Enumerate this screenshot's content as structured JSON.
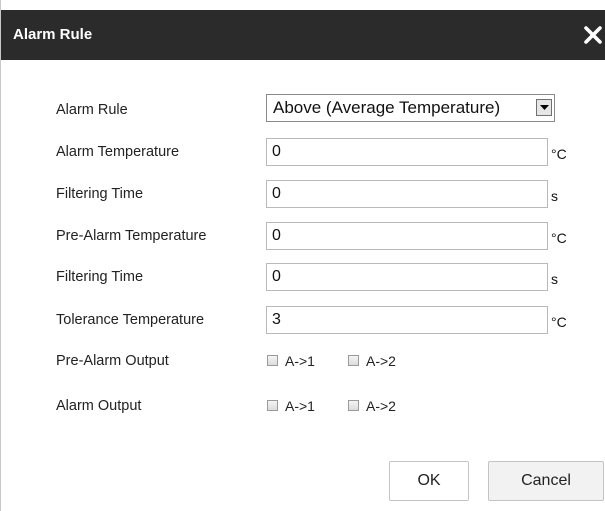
{
  "dialog": {
    "title": "Alarm Rule",
    "close_icon": "close-icon"
  },
  "form": {
    "alarm_rule": {
      "label": "Alarm Rule",
      "selected": "Above (Average Temperature)"
    },
    "alarm_temperature": {
      "label": "Alarm Temperature",
      "value": "0",
      "unit": "°C"
    },
    "filtering_time_1": {
      "label": "Filtering Time",
      "value": "0",
      "unit": "s"
    },
    "pre_alarm_temperature": {
      "label": "Pre-Alarm Temperature",
      "value": "0",
      "unit": "°C"
    },
    "filtering_time_2": {
      "label": "Filtering Time",
      "value": "0",
      "unit": "s"
    },
    "tolerance_temperature": {
      "label": "Tolerance Temperature",
      "value": "3",
      "unit": "°C"
    },
    "pre_alarm_output": {
      "label": "Pre-Alarm Output",
      "options": [
        {
          "label": "A->1",
          "checked": false
        },
        {
          "label": "A->2",
          "checked": false
        }
      ]
    },
    "alarm_output": {
      "label": "Alarm Output",
      "options": [
        {
          "label": "A->1",
          "checked": false
        },
        {
          "label": "A->2",
          "checked": false
        }
      ]
    }
  },
  "buttons": {
    "ok": "OK",
    "cancel": "Cancel"
  },
  "colors": {
    "titlebar": "#2b2b2b",
    "title_text": "#ffffff",
    "background": "#ffffff"
  }
}
